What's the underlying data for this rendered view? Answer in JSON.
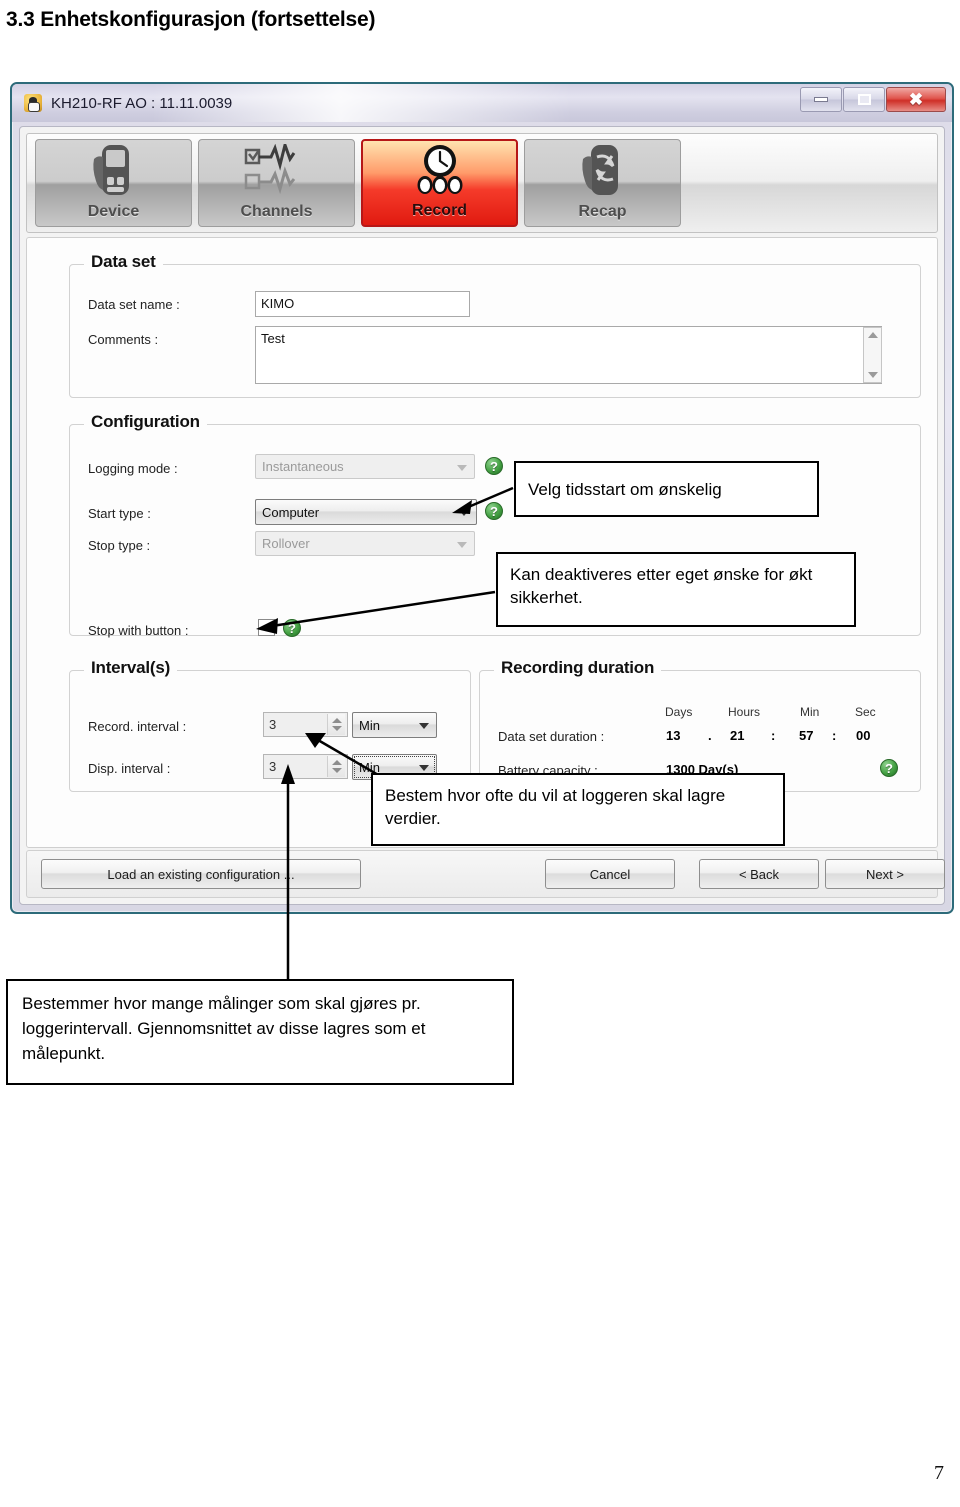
{
  "page": {
    "heading": "3.3 Enhetskonfigurasjon (fortsettelse)",
    "number": "7"
  },
  "window": {
    "title": "KH210-RF AO : 11.11.0039",
    "icon": "app-icon",
    "controls": {
      "minimize": "minimize",
      "maximize": "maximize",
      "close": "close"
    }
  },
  "toolbar": {
    "tabs": [
      {
        "label": "Device",
        "icon": "device-icon",
        "active": false
      },
      {
        "label": "Channels",
        "icon": "channels-icon",
        "active": false
      },
      {
        "label": "Record",
        "icon": "record-clock-icon",
        "active": true
      },
      {
        "label": "Recap",
        "icon": "recap-icon",
        "active": false
      }
    ],
    "active_color": "#e01a10"
  },
  "dataset": {
    "group_title": "Data set",
    "name_label": "Data set name :",
    "name_value": "KIMO",
    "comments_label": "Comments :",
    "comments_value": "Test"
  },
  "configuration": {
    "group_title": "Configuration",
    "logging_mode_label": "Logging mode :",
    "logging_mode_value": "Instantaneous",
    "start_type_label": "Start type :",
    "start_type_value": "Computer",
    "stop_type_label": "Stop type :",
    "stop_type_value": "Rollover",
    "stop_with_button_label": "Stop with button :",
    "stop_with_button_checked": false,
    "help_glyph": "?"
  },
  "intervals": {
    "group_title": "Interval(s)",
    "record_label": "Record. interval :",
    "record_value": "3",
    "record_unit": "Min",
    "disp_label": "Disp. interval :",
    "disp_value": "3",
    "disp_unit": "Min"
  },
  "duration": {
    "group_title": "Recording duration",
    "headers": [
      "Days",
      "Hours",
      "Min",
      "Sec"
    ],
    "dataset_duration_label": "Data set duration :",
    "days": "13",
    "sep1": ".",
    "hours": "21",
    "sep2": ":",
    "minutes": "57",
    "sep3": ":",
    "seconds": "00",
    "battery_label": "Battery capacity :",
    "battery_value": "1300 Day(s)",
    "help_glyph": "?"
  },
  "buttons": {
    "load": "Load an existing configuration ...",
    "cancel": "Cancel",
    "back": "< Back",
    "next": "Next >"
  },
  "annotations": {
    "start_time": "Velg tidsstart om ønskelig",
    "deactivate": "Kan deaktiveres etter eget ønske for økt sikkerhet.",
    "interval": "Bestem hvor ofte du vil at loggeren skal lagre verdier.",
    "measurements": "Bestemmer hvor mange målinger som skal gjøres pr. loggerintervall. Gjennomsnittet av disse lagres som et målepunkt."
  }
}
